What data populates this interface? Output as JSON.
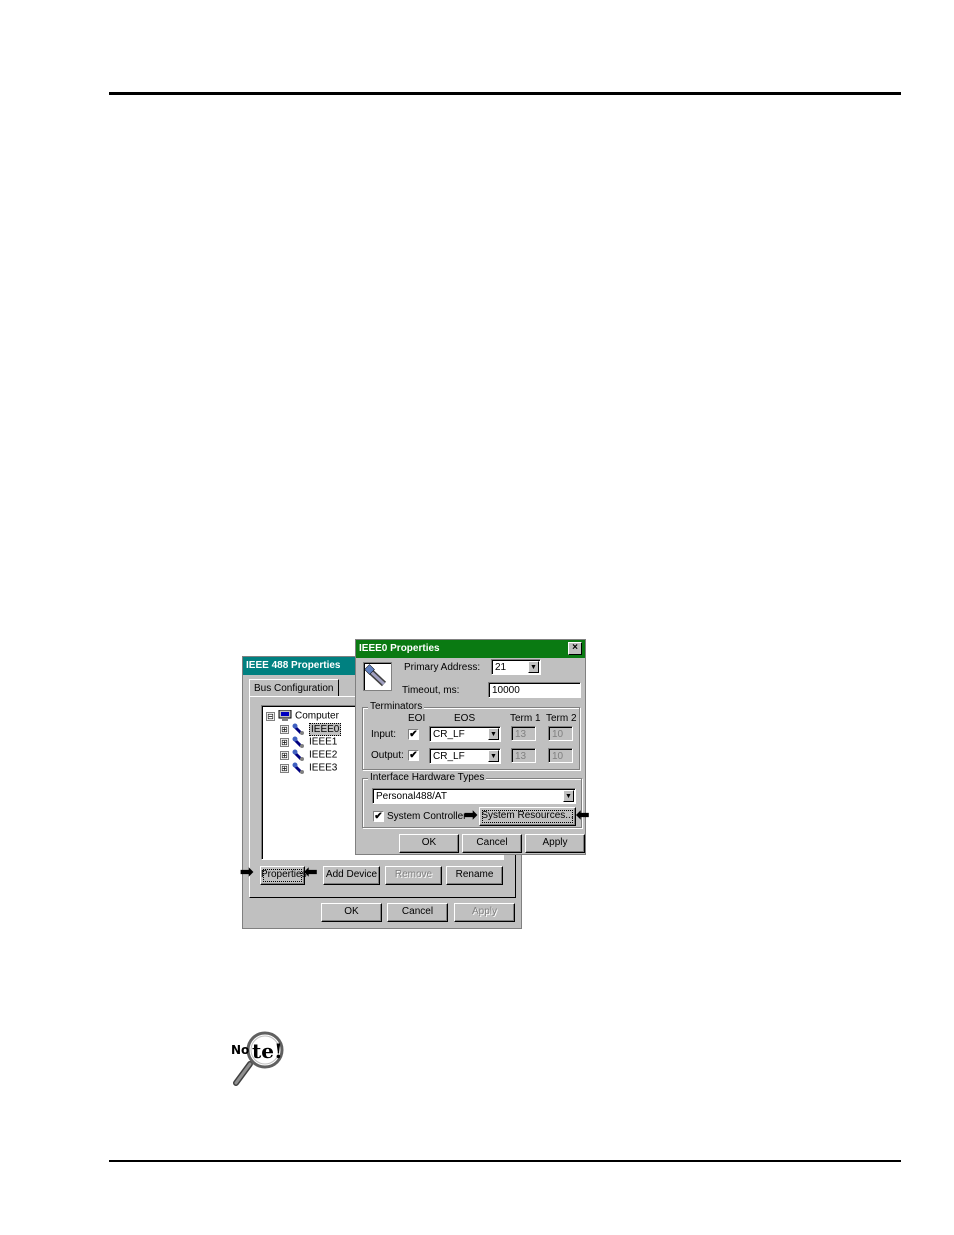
{
  "bus_dialog": {
    "title": "IEEE 488 Properties",
    "tab_label": "Bus Configuration",
    "tree": [
      {
        "label": "Computer",
        "expander": "⊟"
      },
      {
        "label": "IEEE0",
        "expander": "⊞"
      },
      {
        "label": "IEEE1",
        "expander": "⊞"
      },
      {
        "label": "IEEE2",
        "expander": "⊞"
      },
      {
        "label": "IEEE3",
        "expander": "⊞"
      }
    ],
    "buttons": {
      "properties": "Properties",
      "add_device": "Add Device",
      "remove": "Remove",
      "rename": "Rename",
      "ok": "OK",
      "cancel": "Cancel",
      "apply": "Apply"
    }
  },
  "props_dialog": {
    "title": "IEEE0 Properties",
    "close_glyph": "×",
    "primary_address_label": "Primary Address:",
    "primary_address_value": "21",
    "timeout_label": "Timeout, ms:",
    "timeout_value": "10000",
    "terminators": {
      "group_label": "Terminators",
      "col_eoi": "EOI",
      "col_eos": "EOS",
      "col_term1": "Term 1",
      "col_term2": "Term 2",
      "input_label": "Input:",
      "input_eoi_checked": "✔",
      "input_eos": "CR_LF",
      "input_term1": "13",
      "input_term2": "10",
      "output_label": "Output:",
      "output_eoi_checked": "✔",
      "output_eos": "CR_LF",
      "output_term1": "13",
      "output_term2": "10"
    },
    "hardware": {
      "group_label": "Interface Hardware Types",
      "type_value": "Personal488/AT",
      "system_controller_label": "System Controller",
      "system_controller_checked": "✔",
      "system_resources_button": "System Resources..."
    },
    "buttons": {
      "ok": "OK",
      "cancel": "Cancel",
      "apply": "Apply"
    }
  },
  "arrows": {
    "right": "➡",
    "left": "⬅"
  },
  "dropdown_glyph": "▼",
  "note_icon_text": {
    "prefix": "No",
    "bubble": "te!"
  }
}
